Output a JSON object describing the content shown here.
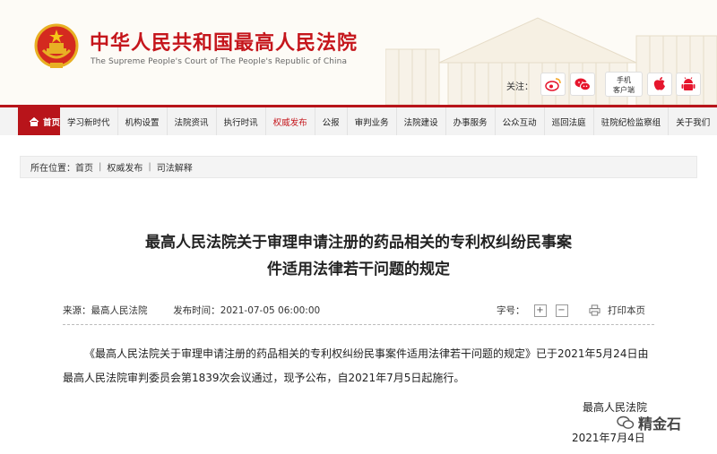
{
  "header": {
    "title": "中华人民共和国最高人民法院",
    "subtitle": "The Supreme People's Court of The People's Republic of China",
    "follow_label": "关注：",
    "mobile_label_line1": "手机",
    "mobile_label_line2": "客户端",
    "icons": [
      "emblem-icon",
      "weibo-icon",
      "wechat-icon",
      "apple-icon",
      "android-icon"
    ]
  },
  "nav": {
    "home": "首页",
    "items": [
      "学习新时代",
      "机构设置",
      "法院资讯",
      "执行时讯",
      "权威发布",
      "公报",
      "审判业务",
      "法院建设",
      "办事服务",
      "公众互动",
      "巡回法庭",
      "驻院纪检监察组",
      "关于我们"
    ],
    "active_index": 4
  },
  "breadcrumb": {
    "label": "所在位置：",
    "items": [
      "首页",
      "权威发布",
      "司法解释"
    ],
    "separator": "|"
  },
  "article": {
    "title_line1": "最高人民法院关于审理申请注册的药品相关的专利权纠纷民事案",
    "title_line2": "件适用法律若干问题的规定",
    "source_label": "来源：",
    "source": "最高人民法院",
    "date_label": "发布时间：",
    "date": "2021-07-05 06:00:00",
    "fontsize_label": "字号：",
    "plus": "+",
    "minus": "−",
    "print_label": "打印本页",
    "body": "《最高人民法院关于审理申请注册的药品相关的专利权纠纷民事案件适用法律若干问题的规定》已于2021年5月24日由最高人民法院审判委员会第1839次会议通过，现予公布，自2021年7月5日起施行。",
    "sign_org": "最高人民法院",
    "sign_date": "2021年7月4日"
  },
  "watermark": "精金石",
  "colors": {
    "brand_red": "#c5161c",
    "nav_red": "#b8141a",
    "nav_bg": "#f3f3f3"
  }
}
